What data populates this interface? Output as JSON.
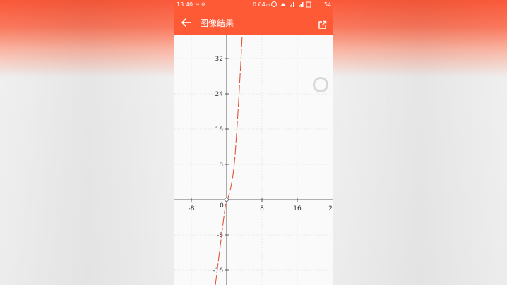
{
  "status_bar": {
    "time": "13:40",
    "left_icons": "∞ ⊛",
    "net_speed": "0.64",
    "net_unit": "k/s",
    "battery": "54"
  },
  "app_bar": {
    "title": "图像结果",
    "back_icon": "arrow-left-icon",
    "share_icon": "share-icon"
  },
  "graph": {
    "x_ticks": [
      "-8",
      "0",
      "8",
      "16",
      "2"
    ],
    "y_ticks": [
      "32",
      "24",
      "16",
      "8",
      "-8",
      "-16"
    ],
    "origin_label": "0"
  },
  "colors": {
    "accent": "#ff5a36",
    "curve": "#e2553a"
  }
}
